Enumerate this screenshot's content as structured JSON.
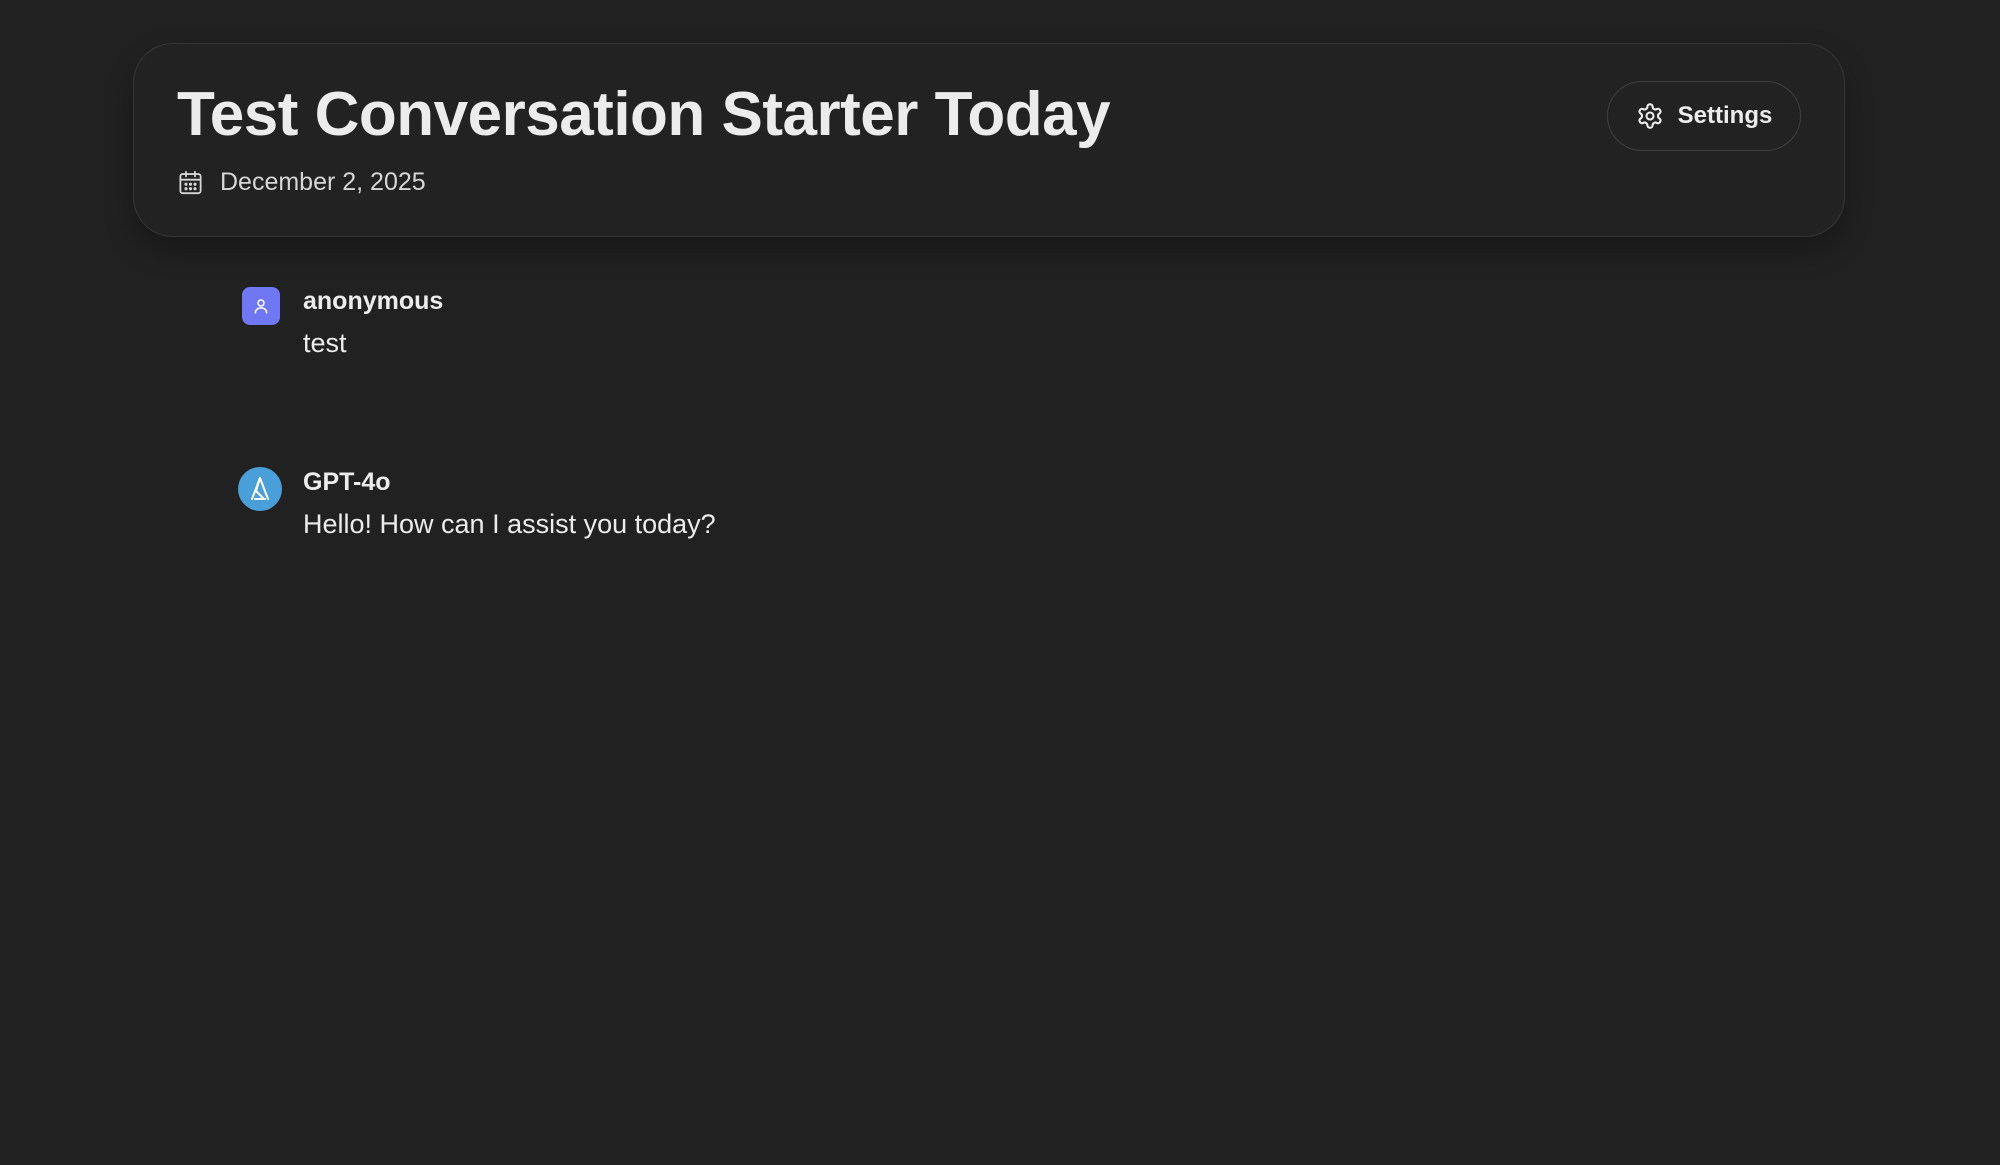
{
  "header": {
    "title": "Test Conversation Starter Today",
    "date": "December 2, 2025",
    "settings_label": "Settings"
  },
  "messages": [
    {
      "sender": "anonymous",
      "text": "test",
      "avatar_icon": "user-icon",
      "avatar_color": "#7077f2"
    },
    {
      "sender": "GPT-4o",
      "text": "Hello! How can I assist you today?",
      "avatar_icon": "model-logo-icon",
      "avatar_color": "#4a9fd8"
    }
  ],
  "colors": {
    "background": "#212121",
    "text": "#ececec"
  }
}
